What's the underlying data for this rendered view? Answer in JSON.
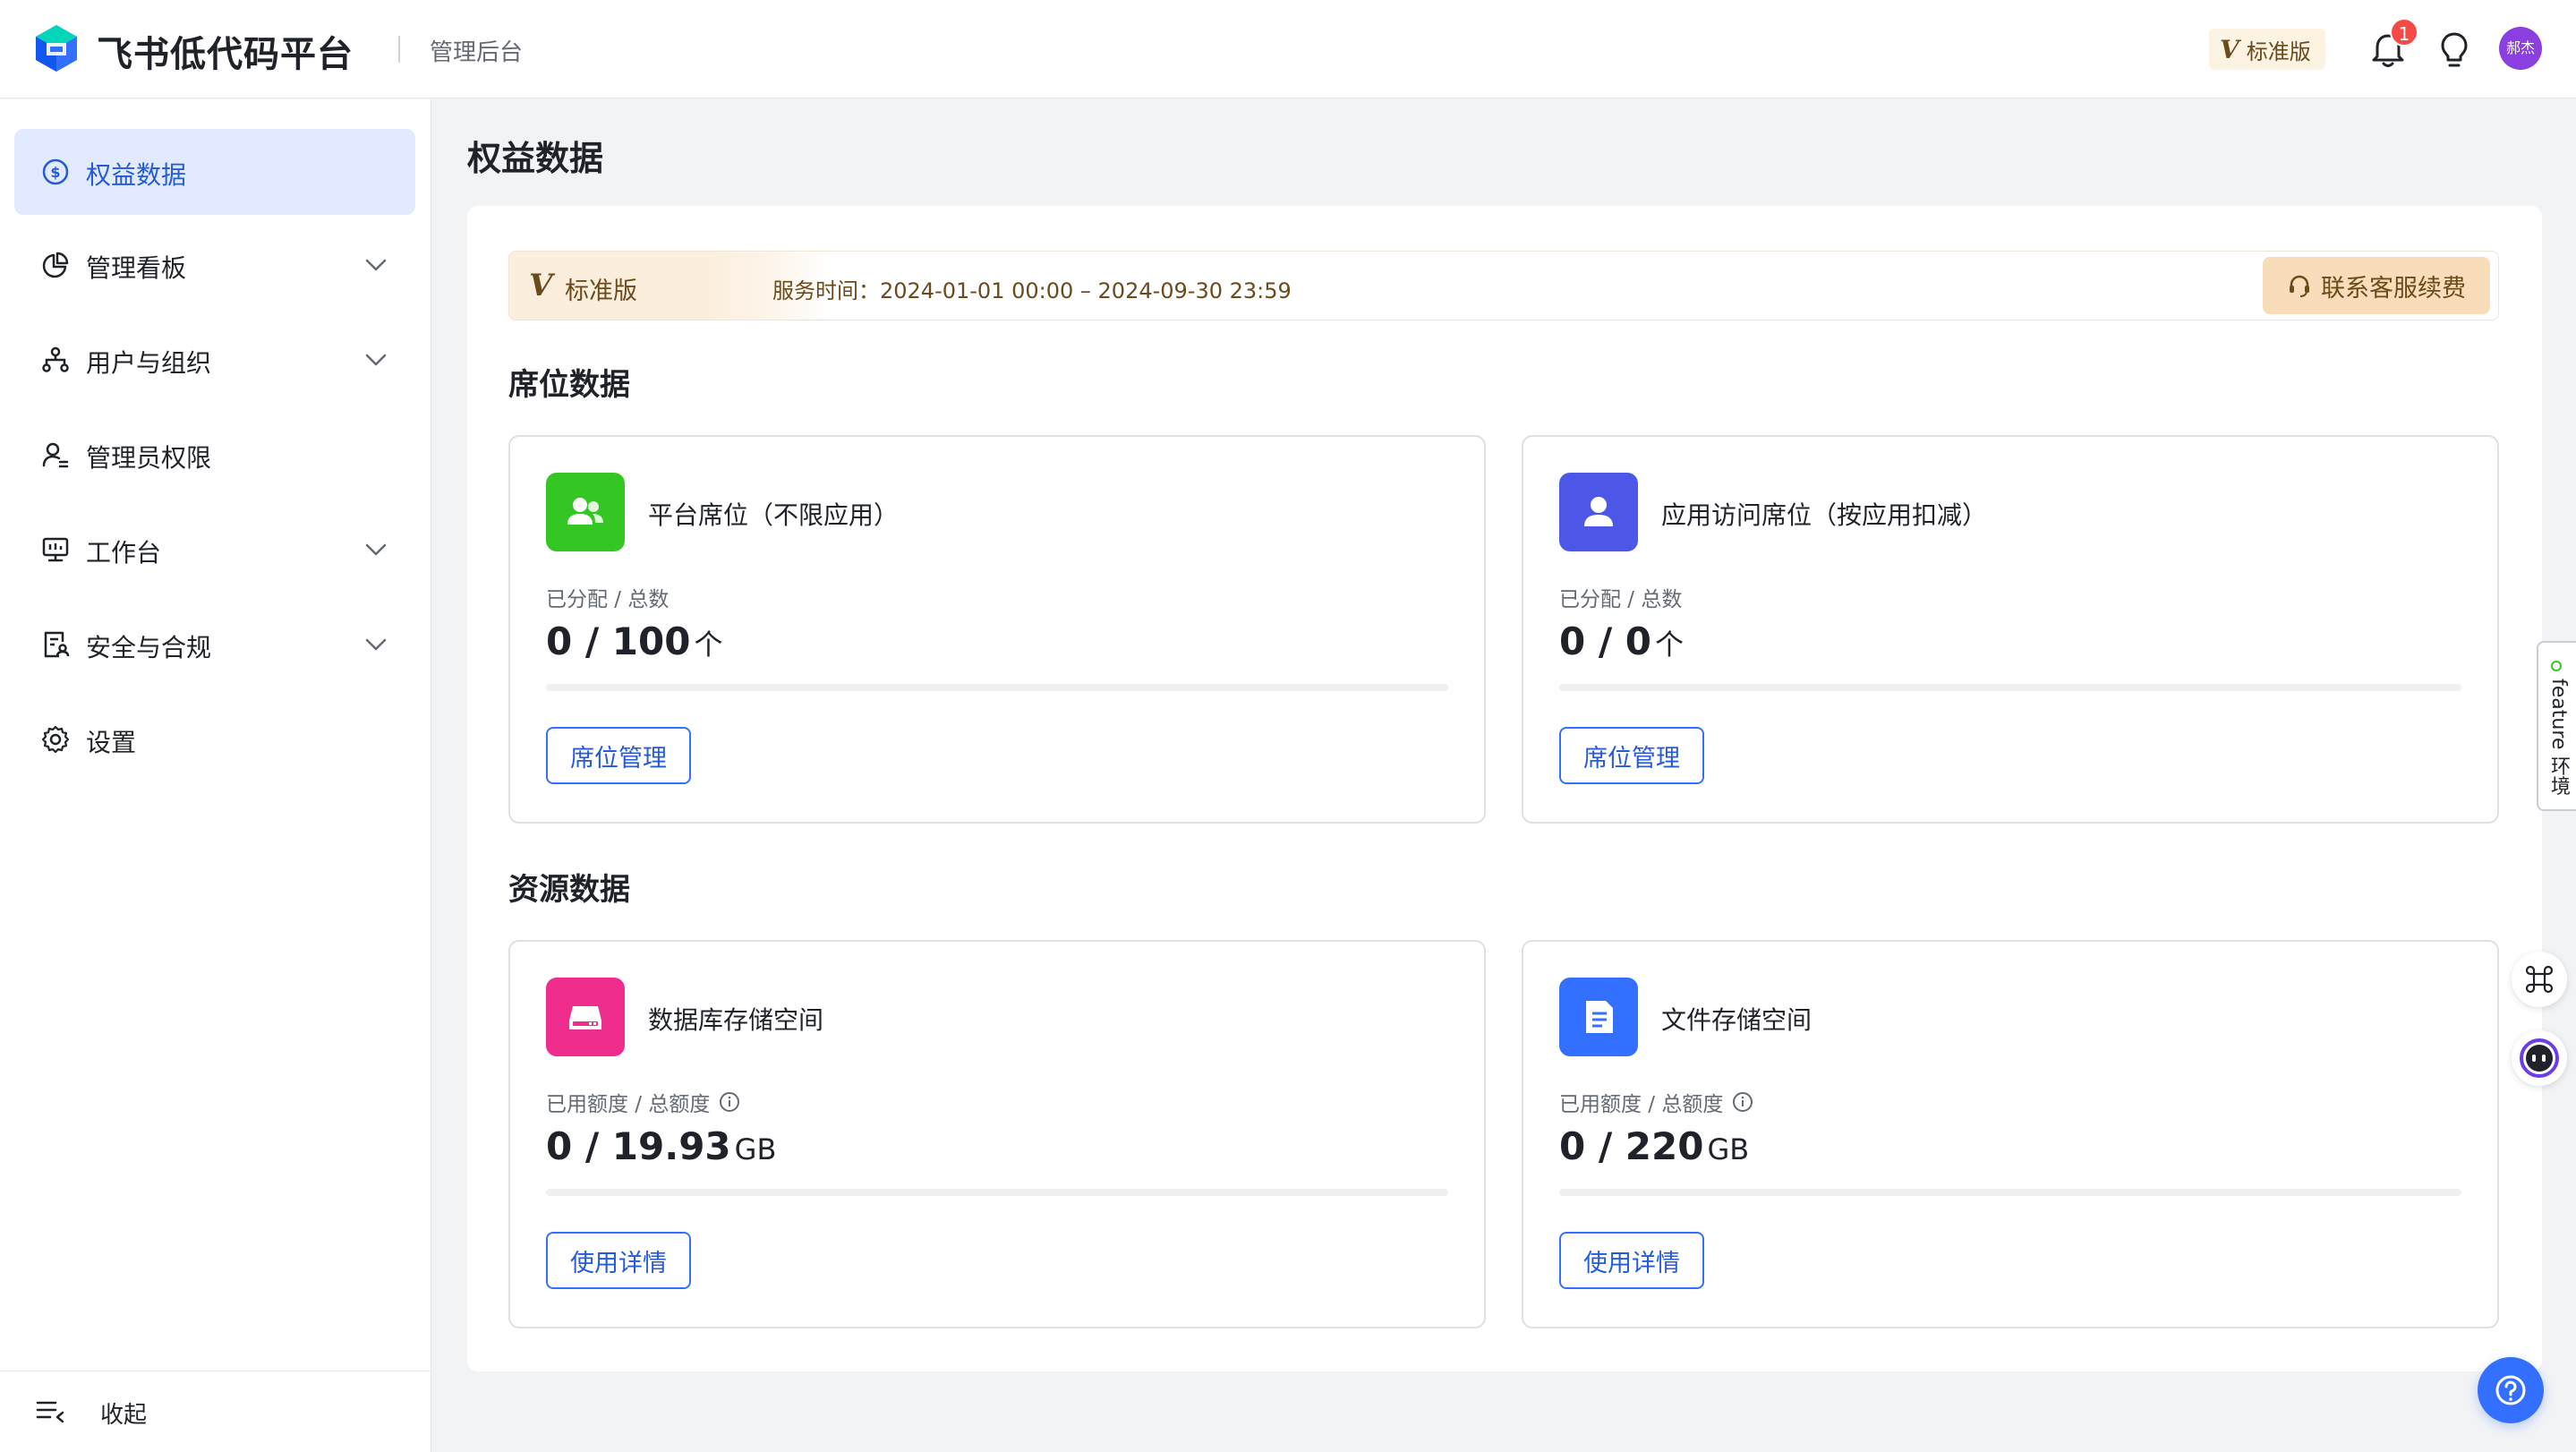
{
  "header": {
    "brand": "飞书低代码平台",
    "subtitle": "管理后台",
    "plan_mark": "V",
    "plan_label": "标准版",
    "notification_count": "1",
    "avatar_text": "郝杰"
  },
  "sidebar": {
    "items": [
      {
        "label": "权益数据",
        "icon": "dollar-circle-icon",
        "active": true,
        "expandable": false
      },
      {
        "label": "管理看板",
        "icon": "pie-chart-icon",
        "active": false,
        "expandable": true
      },
      {
        "label": "用户与组织",
        "icon": "org-tree-icon",
        "active": false,
        "expandable": true
      },
      {
        "label": "管理员权限",
        "icon": "admin-user-icon",
        "active": false,
        "expandable": false
      },
      {
        "label": "工作台",
        "icon": "monitor-icon",
        "active": false,
        "expandable": true
      },
      {
        "label": "安全与合规",
        "icon": "security-doc-icon",
        "active": false,
        "expandable": true
      },
      {
        "label": "设置",
        "icon": "gear-icon",
        "active": false,
        "expandable": false
      }
    ],
    "collapse_label": "收起"
  },
  "page": {
    "title": "权益数据",
    "banner": {
      "mark": "V",
      "plan": "标准版",
      "service_time": "服务时间：2024-01-01 00:00 – 2024-09-30 23:59",
      "renew_button": "联系客服续费"
    },
    "seat_section_title": "席位数据",
    "resource_section_title": "资源数据",
    "cards": [
      {
        "title": "平台席位（不限应用）",
        "icon": "users-icon",
        "color": "#34c724",
        "metric_label": "已分配 / 总数",
        "value": "0 / 100",
        "unit": "个",
        "progress": 0,
        "button": "席位管理",
        "info": false
      },
      {
        "title": "应用访问席位（按应用扣减）",
        "icon": "user-icon",
        "color": "#4c57e8",
        "metric_label": "已分配 / 总数",
        "value": "0 / 0",
        "unit": "个",
        "progress": 0,
        "button": "席位管理",
        "info": false
      },
      {
        "title": "数据库存储空间",
        "icon": "database-icon",
        "color": "#f02d8c",
        "metric_label": "已用额度 / 总额度",
        "value": "0 / 19.93",
        "unit": "GB",
        "progress": 0,
        "button": "使用详情",
        "info": true
      },
      {
        "title": "文件存储空间",
        "icon": "file-icon",
        "color": "#3370ff",
        "metric_label": "已用额度 / 总额度",
        "value": "0 / 220",
        "unit": "GB",
        "progress": 0,
        "button": "使用详情",
        "info": true
      }
    ]
  },
  "floating": {
    "feature_tab": "feature 环境"
  }
}
